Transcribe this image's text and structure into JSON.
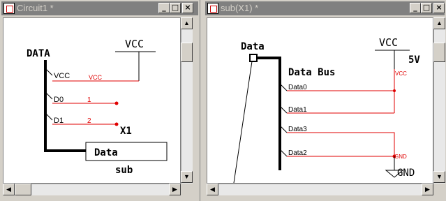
{
  "window1": {
    "title": "Circuit1 *",
    "buttons": {
      "minimize": "_",
      "maximize": "□",
      "close": "×"
    },
    "schematic": {
      "bus_label": "DATA",
      "vcc_power": "VCC",
      "pins": [
        "VCC",
        "D0",
        "D1"
      ],
      "nets": [
        "VCC",
        "1",
        "2"
      ],
      "instance": "X1",
      "block_port": "Data",
      "block_name": "sub"
    }
  },
  "window2": {
    "title": "sub(X1) *",
    "buttons": {
      "minimize": "_",
      "maximize": "□",
      "close": "×"
    },
    "schematic": {
      "port_label": "Data",
      "bus_label": "Data Bus",
      "vcc_power": "VCC",
      "voltage": "5V",
      "vcc_net": "VCC",
      "pins": [
        "Data0",
        "Data1",
        "Data3",
        "Data2"
      ],
      "gnd_net": "GND",
      "gnd_power": "GND"
    }
  },
  "scroll_arrows": {
    "up": "▲",
    "down": "▼",
    "left": "◀",
    "right": "▶"
  }
}
